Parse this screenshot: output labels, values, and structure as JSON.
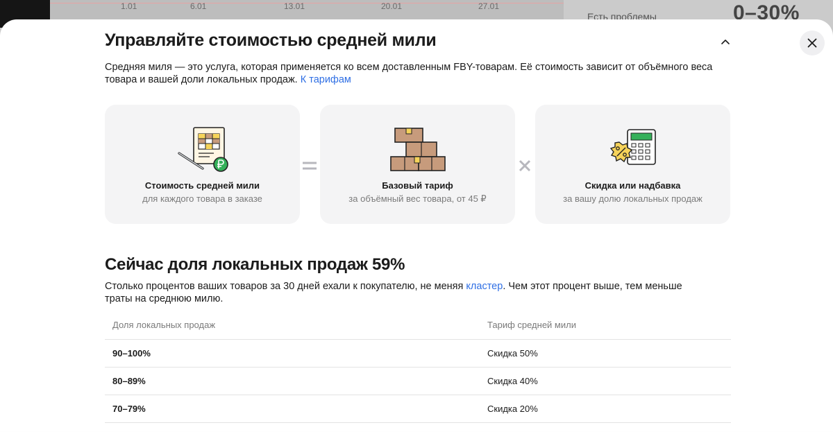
{
  "background": {
    "chart_ticks": [
      "1.01",
      "6.01",
      "13.01",
      "20.01",
      "27.01"
    ],
    "problems_label": "Есть проблемы",
    "percent_range": "0–30%"
  },
  "modal": {
    "title": "Управляйте стоимостью средней мили",
    "intro_text": "Средняя миля — это услуга, которая применяется ко всем доставленным FBY-товарам. Её стоимость зависит от объёмного веса товара и вашей доли локальных продаж.",
    "intro_link": "К тарифам",
    "cards": [
      {
        "title": "Стоимость средней мили",
        "subtitle": "для каждого товара в заказе",
        "icon": "invoice-ruble-icon"
      },
      {
        "title": "Базовый тариф",
        "subtitle": "за объёмный вес товара, от 45 ₽",
        "icon": "boxes-icon"
      },
      {
        "title": "Скидка или надбавка",
        "subtitle": "за вашу долю локальных продаж",
        "icon": "calculator-percent-icon"
      }
    ],
    "operators": [
      "=",
      "×"
    ],
    "section_title": "Сейчас доля локальных продаж 59%",
    "section_text_before": "Столько процентов ваших товаров за 30 дней ехали к покупателю, не меняя",
    "section_link": "кластер",
    "section_text_after": ". Чем этот процент выше, тем меньше траты на среднюю милю.",
    "table": {
      "headers": [
        "Доля локальных продаж",
        "Тариф средней мили"
      ],
      "rows": [
        {
          "share": "90–100%",
          "rate": "Скидка 50%"
        },
        {
          "share": "80–89%",
          "rate": "Скидка 40%"
        },
        {
          "share": "70–79%",
          "rate": "Скидка 20%"
        }
      ]
    }
  },
  "colors": {
    "link": "#2f6fe4",
    "accent_yellow": "#f6d35a",
    "green": "#35b05a"
  }
}
